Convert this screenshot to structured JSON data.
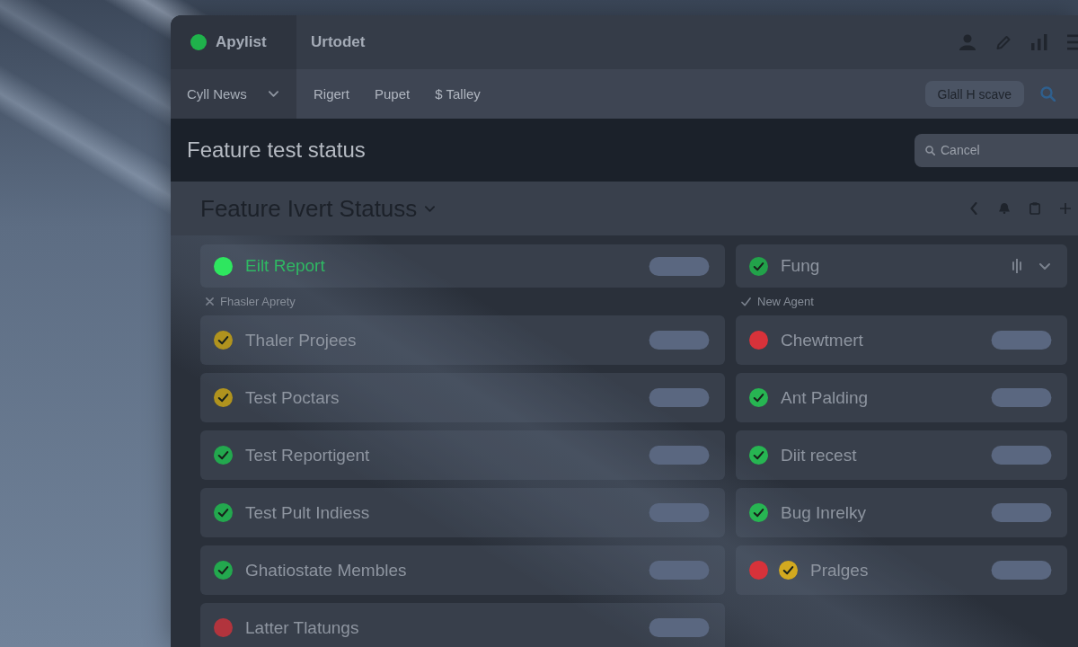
{
  "app": {
    "name": "Apylist",
    "title": "Urtodet"
  },
  "nav": {
    "dropdown": "Cyll News",
    "links": [
      "Rigert",
      "Pupet",
      "$ Talley"
    ],
    "button": "Glall H scave"
  },
  "header": {
    "title": "Feature test status",
    "search": {
      "placeholder": "Cancel"
    }
  },
  "board": {
    "title": "Feature Ivert Statuss"
  },
  "columns": [
    {
      "top": {
        "label": "Eilt Report",
        "selected": true,
        "kind": "pill",
        "marks": [
          {
            "kind": "dot",
            "color": "#2ee65f"
          }
        ]
      },
      "section": {
        "kind": "cross",
        "label": "Fhasler Aprety"
      },
      "rows": [
        {
          "label": "Thaler Projees",
          "selected": false,
          "kind": "pill",
          "marks": [
            {
              "kind": "check",
              "color": "#b0931e"
            }
          ]
        },
        {
          "label": "Test Poctars",
          "selected": false,
          "kind": "pill",
          "marks": [
            {
              "kind": "check",
              "color": "#b0931e"
            }
          ]
        },
        {
          "label": "Test Reportigent",
          "selected": false,
          "kind": "pill",
          "marks": [
            {
              "kind": "check",
              "color": "#23a84e"
            }
          ]
        },
        {
          "label": "Test Pult Indiess",
          "selected": false,
          "kind": "pill",
          "marks": [
            {
              "kind": "check",
              "color": "#23a84e"
            }
          ]
        },
        {
          "label": "Ghatiostate Membles",
          "selected": false,
          "kind": "pill",
          "marks": [
            {
              "kind": "check",
              "color": "#23a84e"
            }
          ]
        },
        {
          "label": "Latter Tlatungs",
          "selected": false,
          "kind": "pill",
          "marks": [
            {
              "kind": "dot",
              "color": "#b2343d"
            }
          ]
        }
      ]
    },
    {
      "top": {
        "label": "Fung",
        "selected": false,
        "kind": "controls",
        "marks": [
          {
            "kind": "check",
            "color": "#22a24a"
          }
        ]
      },
      "section": {
        "kind": "check",
        "label": "New Agent"
      },
      "rows": [
        {
          "label": "Chewtmert",
          "selected": false,
          "kind": "pill",
          "marks": [
            {
              "kind": "dot",
              "color": "#d8323a"
            }
          ]
        },
        {
          "label": "Ant Palding",
          "selected": false,
          "kind": "pill",
          "marks": [
            {
              "kind": "check",
              "color": "#27b552"
            }
          ]
        },
        {
          "label": "Diit recest",
          "selected": false,
          "kind": "pill",
          "marks": [
            {
              "kind": "check",
              "color": "#27b552"
            }
          ]
        },
        {
          "label": "Bug Inrelky",
          "selected": false,
          "kind": "pill",
          "marks": [
            {
              "kind": "check",
              "color": "#27b552"
            }
          ]
        },
        {
          "label": "Pralges",
          "selected": false,
          "kind": "pill",
          "marks": [
            {
              "kind": "dot",
              "color": "#d8323a"
            },
            {
              "kind": "check",
              "color": "#d2a91f"
            }
          ]
        }
      ]
    }
  ]
}
